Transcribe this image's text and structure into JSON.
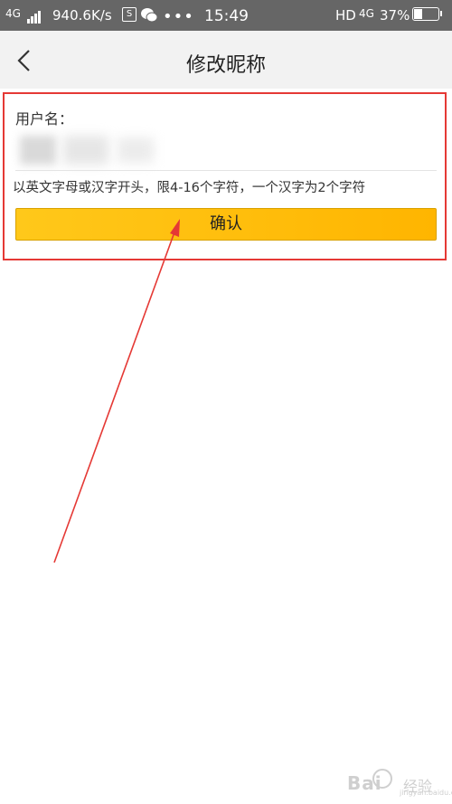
{
  "status_bar": {
    "network": "4G",
    "speed": "940.6K/s",
    "s_badge": "S",
    "dots": "•••",
    "time": "15:49",
    "hd": "HD",
    "network_2": "4G",
    "battery": "37%"
  },
  "nav": {
    "title": "修改昵称"
  },
  "form": {
    "username_label": "用户名：",
    "username_value": "",
    "hint": "以英文字母或汉字开头，限4-16个字符，一个汉字为2个字符",
    "confirm_label": "确认"
  },
  "annotation": {
    "color": "#e53935"
  },
  "watermark": {
    "main": "Bai",
    "cn": "经验",
    "sub": "jingyan.baidu.com"
  },
  "colors": {
    "status_bar": "#666666",
    "nav_bar": "#f2f2f2",
    "button": "#ffc000",
    "highlight": "#e53935"
  }
}
